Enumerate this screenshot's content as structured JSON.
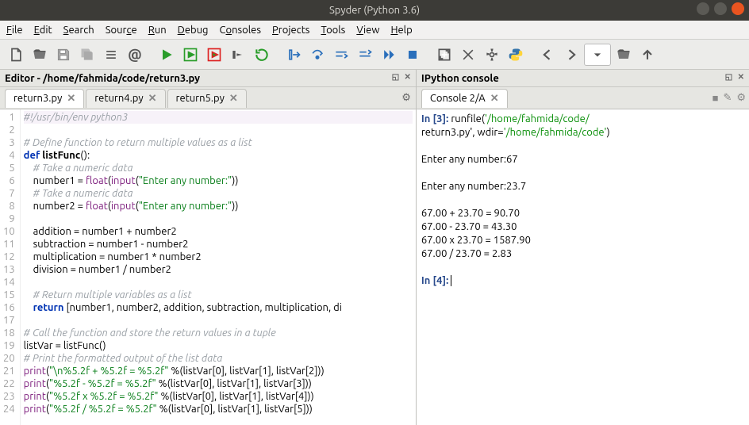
{
  "window": {
    "title": "Spyder (Python 3.6)"
  },
  "menu": {
    "file": "File",
    "edit": "Edit",
    "search": "Search",
    "source": "Source",
    "run": "Run",
    "debug": "Debug",
    "consoles": "Consoles",
    "projects": "Projects",
    "tools": "Tools",
    "view": "View",
    "help": "Help"
  },
  "editor": {
    "title": "Editor - /home/fahmida/code/return3.py",
    "tabs": [
      {
        "label": "return3.py",
        "active": true
      },
      {
        "label": "return4.py",
        "active": false
      },
      {
        "label": "return5.py",
        "active": false
      }
    ],
    "lines": [
      {
        "n": 1,
        "cls": "hl-currentline",
        "html": "<span class='c-comment'>#!/usr/bin/env python3</span>"
      },
      {
        "n": 2,
        "html": ""
      },
      {
        "n": 3,
        "html": "<span class='c-comment'># Define function to return multiple values as a list</span>"
      },
      {
        "n": 4,
        "html": "<span class='c-kw'>def</span> <span class='c-def'>listFunc</span>():"
      },
      {
        "n": 5,
        "html": "    <span class='c-comment'># Take a numeric data</span>"
      },
      {
        "n": 6,
        "html": "    number1 = <span class='c-builtin'>float</span>(<span class='c-builtin'>input</span>(<span class='c-str'>\"Enter any number:\"</span>))"
      },
      {
        "n": 7,
        "html": "    <span class='c-comment'># Take a numeric data</span>"
      },
      {
        "n": 8,
        "html": "    number2 = <span class='c-builtin'>float</span>(<span class='c-builtin'>input</span>(<span class='c-str'>\"Enter any number:\"</span>))"
      },
      {
        "n": 9,
        "html": ""
      },
      {
        "n": 10,
        "html": "    addition = number1 + number2"
      },
      {
        "n": 11,
        "html": "    subtraction = number1 - number2"
      },
      {
        "n": 12,
        "html": "    multiplication = number1 * number2"
      },
      {
        "n": 13,
        "html": "    division = number1 / number2"
      },
      {
        "n": 14,
        "html": ""
      },
      {
        "n": 15,
        "html": "    <span class='c-comment'># Return multiple variables as a list</span>"
      },
      {
        "n": 16,
        "html": "    <span class='c-kw'>return</span> [number1, number2, addition, subtraction, multiplication, di"
      },
      {
        "n": 17,
        "html": ""
      },
      {
        "n": 18,
        "html": "<span class='c-comment'># Call the function and store the return values in a tuple</span>"
      },
      {
        "n": 19,
        "html": "listVar = listFunc()"
      },
      {
        "n": 20,
        "html": "<span class='c-comment'># Print the formatted output of the list data</span>"
      },
      {
        "n": 21,
        "html": "<span class='c-builtin'>print</span>(<span class='c-str'>\"\\n%5.2f + %5.2f = %5.2f\"</span> %(listVar[<span class='c-num'>0</span>], listVar[<span class='c-num'>1</span>], listVar[<span class='c-num'>2</span>]))"
      },
      {
        "n": 22,
        "html": "<span class='c-builtin'>print</span>(<span class='c-str'>\"%5.2f - %5.2f = %5.2f\"</span> %(listVar[<span class='c-num'>0</span>], listVar[<span class='c-num'>1</span>], listVar[<span class='c-num'>3</span>]))"
      },
      {
        "n": 23,
        "html": "<span class='c-builtin'>print</span>(<span class='c-str'>\"%5.2f x %5.2f = %5.2f\"</span> %(listVar[<span class='c-num'>0</span>], listVar[<span class='c-num'>1</span>], listVar[<span class='c-num'>4</span>]))"
      },
      {
        "n": 24,
        "html": "<span class='c-builtin'>print</span>(<span class='c-str'>\"%5.2f / %5.2f = %5.2f\"</span> %(listVar[<span class='c-num'>0</span>], listVar[<span class='c-num'>1</span>], listVar[<span class='c-num'>5</span>]))"
      }
    ]
  },
  "console": {
    "title": "IPython console",
    "tab": "Console 2/A",
    "lines": [
      "<span class='cp-in'>In [3]:</span> <span class='cp-func'>runfile(</span><span class='cp-str'>'/home/fahmida/code/",
      "return3.py'</span>, wdir=<span class='cp-str'>'/home/fahmida/code'</span>)",
      "",
      "Enter any number:67",
      "",
      "Enter any number:23.7",
      "",
      "67.00 + 23.70 = 90.70",
      "67.00 - 23.70 = 43.30",
      "67.00 x 23.70 = 1587.90",
      "67.00 / 23.70 =  2.83",
      "",
      "<span class='cp-in'>In [4]:</span> <span class='blink'>&nbsp;</span>"
    ]
  }
}
